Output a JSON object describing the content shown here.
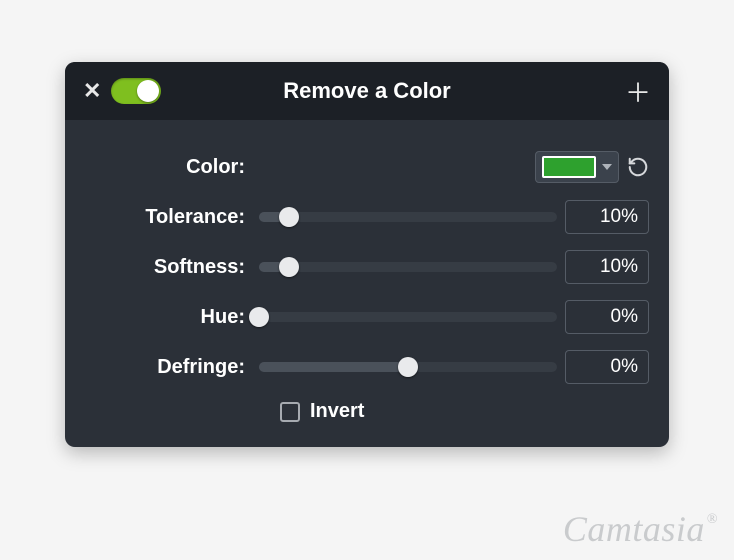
{
  "title": "Remove a Color",
  "color": {
    "label": "Color:",
    "swatch_hex": "#2ea12e"
  },
  "sliders": {
    "tolerance": {
      "label": "Tolerance:",
      "value": "10%",
      "percent": 10
    },
    "softness": {
      "label": "Softness:",
      "value": "10%",
      "percent": 10
    },
    "hue": {
      "label": "Hue:",
      "value": "0%",
      "percent": 0
    },
    "defringe": {
      "label": "Defringe:",
      "value": "0%",
      "percent": 50
    }
  },
  "invert": {
    "label": "Invert",
    "checked": false
  },
  "watermark": "Camtasia"
}
